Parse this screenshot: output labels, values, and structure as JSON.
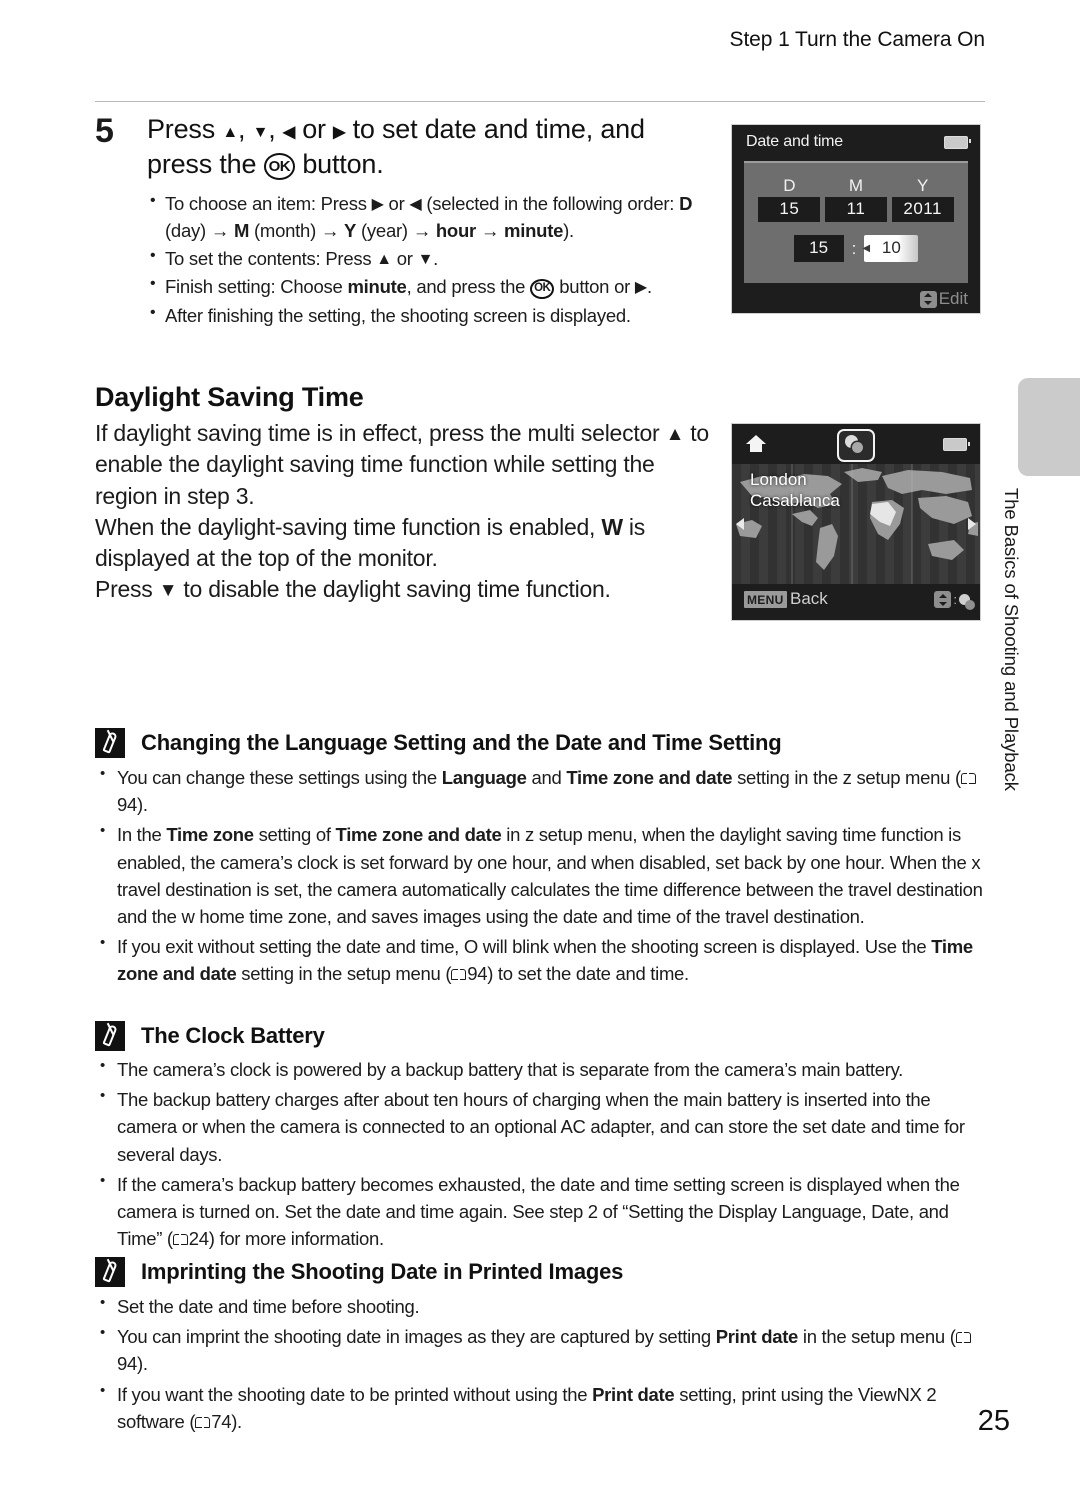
{
  "header": {
    "running_head": "Step 1 Turn the Camera On"
  },
  "step": {
    "number": "5",
    "title_part1": "Press ",
    "title_part2": ", ",
    "title_part3": ", ",
    "title_part4": " or ",
    "title_part5": " to set date and time, and press the ",
    "title_part6": " button.",
    "ok_label": "OK",
    "bullets": [
      {
        "segments": [
          {
            "t": "To choose an item: Press "
          },
          {
            "sym": "tri-right"
          },
          {
            "t": " or "
          },
          {
            "sym": "tri-left"
          },
          {
            "t": " (selected in the following order: "
          },
          {
            "t": "D",
            "b": true
          },
          {
            "t": " (day) "
          },
          {
            "sym": "arrow"
          },
          {
            "t": " "
          },
          {
            "t": "M",
            "b": true
          },
          {
            "t": " (month) "
          },
          {
            "sym": "arrow"
          },
          {
            "t": " "
          },
          {
            "t": "Y",
            "b": true
          },
          {
            "t": " (year) "
          },
          {
            "sym": "arrow"
          },
          {
            "t": " "
          },
          {
            "t": "hour",
            "b": true
          },
          {
            "t": " "
          },
          {
            "sym": "arrow"
          },
          {
            "t": " "
          },
          {
            "t": "minute",
            "b": true
          },
          {
            "t": ")."
          }
        ]
      },
      {
        "segments": [
          {
            "t": "To set the contents: Press "
          },
          {
            "sym": "tri-up"
          },
          {
            "t": " or "
          },
          {
            "sym": "tri-down"
          },
          {
            "t": "."
          }
        ]
      },
      {
        "segments": [
          {
            "t": "Finish setting: Choose "
          },
          {
            "t": "minute",
            "b": true
          },
          {
            "t": ", and press the "
          },
          {
            "sym": "ok"
          },
          {
            "t": " button or "
          },
          {
            "sym": "tri-right"
          },
          {
            "t": "."
          }
        ]
      },
      {
        "segments": [
          {
            "t": "After finishing the setting, the shooting screen is displayed."
          }
        ]
      }
    ]
  },
  "dst_section": {
    "heading": "Daylight Saving Time",
    "paragraphs": [
      {
        "segments": [
          {
            "t": "If daylight saving time is in effect, press the multi selector "
          },
          {
            "sym": "tri-up"
          },
          {
            "t": " to enable the daylight saving time function while setting the region in step 3."
          }
        ]
      },
      {
        "segments": [
          {
            "t": "When the daylight-saving time function is enabled, "
          },
          {
            "t": "W",
            "b": true
          },
          {
            "t": " is displayed at the top of the monitor."
          }
        ]
      },
      {
        "segments": [
          {
            "t": "Press "
          },
          {
            "sym": "tri-down"
          },
          {
            "t": " to disable the daylight saving time function."
          }
        ]
      }
    ]
  },
  "notes": [
    {
      "title": "Changing the Language Setting and the Date and Time Setting",
      "bullets": [
        {
          "segments": [
            {
              "t": "You can change these settings using the "
            },
            {
              "t": "Language",
              "b": true
            },
            {
              "t": " and "
            },
            {
              "t": "Time zone and date",
              "b": true
            },
            {
              "t": " setting in the z setup menu ("
            },
            {
              "sym": "book"
            },
            {
              "t": "94)."
            }
          ]
        },
        {
          "segments": [
            {
              "t": "In the "
            },
            {
              "t": "Time zone",
              "b": true
            },
            {
              "t": " setting of "
            },
            {
              "t": "Time zone and date",
              "b": true
            },
            {
              "t": " in z  setup menu, when the daylight saving time function is enabled, the camera’s clock is set forward by one hour, and when disabled, set back by one hour. When the x  travel destination is set, the camera automatically calculates the time difference between the travel destination and the w  home time zone, and saves images using the date and time of the travel destination."
            }
          ]
        },
        {
          "segments": [
            {
              "t": "If you exit without setting the date and time, O  will blink when the shooting screen is displayed. Use the "
            },
            {
              "t": "Time zone and date",
              "b": true
            },
            {
              "t": " setting in the setup menu ("
            },
            {
              "sym": "book"
            },
            {
              "t": "94) to set the date and time."
            }
          ]
        }
      ]
    },
    {
      "title": "The Clock Battery",
      "bullets": [
        {
          "segments": [
            {
              "t": "The camera’s clock is powered by a backup battery that is separate from the camera’s main battery."
            }
          ]
        },
        {
          "segments": [
            {
              "t": "The backup battery charges after about ten hours of charging when the main battery is inserted into the camera or when the camera is connected to an optional AC adapter, and can store the set date and time for several days."
            }
          ]
        },
        {
          "segments": [
            {
              "t": "If the camera’s backup battery becomes exhausted, the date and time setting screen is displayed when the camera is turned on. Set the date and time again. See step 2 of “Setting the Display Language, Date, and Time” ("
            },
            {
              "sym": "book"
            },
            {
              "t": "24) for more information."
            }
          ]
        }
      ]
    },
    {
      "title": "Imprinting the Shooting Date in Printed Images",
      "bullets": [
        {
          "segments": [
            {
              "t": "Set the date and time before shooting."
            }
          ]
        },
        {
          "segments": [
            {
              "t": "You can imprint the shooting date in images as they are captured by setting "
            },
            {
              "t": "Print date",
              "b": true
            },
            {
              "t": " in the setup menu ("
            },
            {
              "sym": "book"
            },
            {
              "t": "94)."
            }
          ]
        },
        {
          "segments": [
            {
              "t": "If you want the shooting date to be printed without using the "
            },
            {
              "t": "Print date",
              "b": true
            },
            {
              "t": " setting, print using the ViewNX 2 software ("
            },
            {
              "sym": "book"
            },
            {
              "t": "74)."
            }
          ]
        }
      ]
    }
  ],
  "lcd_datetime": {
    "title": "Date and time",
    "battery_icon": "battery-icon",
    "columns": [
      {
        "label": "D",
        "value": "15"
      },
      {
        "label": "M",
        "value": "11"
      },
      {
        "label": "Y",
        "value": "2011"
      }
    ],
    "hour": "15",
    "separator": ":",
    "minute": "10",
    "minute_selected": true,
    "footer_label": "Edit",
    "footer_icon": "up-down-icon"
  },
  "lcd_map": {
    "home_icon": "home-icon",
    "dst_icon": "daylight-saving-icon",
    "battery_icon": "battery-icon",
    "city_line1": "London",
    "city_line2": "Casablanca",
    "menu_chip": "MENU",
    "back_label": "Back",
    "footer_icon": "up-down-icon",
    "footer_separator": ":",
    "footer_dst_icon": "daylight-saving-icon"
  },
  "side_tab": {
    "label": "The Basics of Shooting and Playback"
  },
  "page_number": "25"
}
